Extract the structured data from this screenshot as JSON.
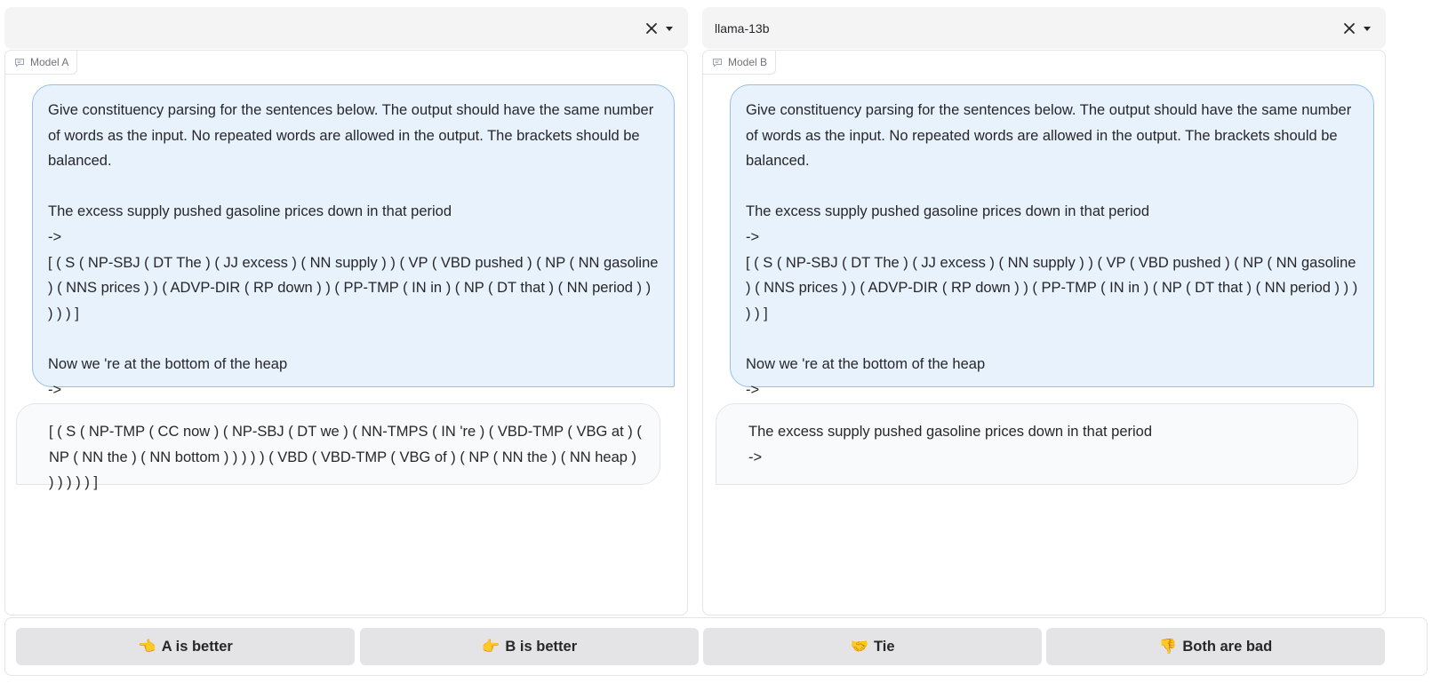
{
  "model_a": {
    "selector_value": "",
    "label": "Model A",
    "prompt": "Give constituency parsing for the sentences below. The output should have the same number of words as the input. No repeated words are allowed in the output. The brackets should be balanced.\n\nThe excess supply pushed gasoline prices down in that period\n->\n[ ( S ( NP-SBJ ( DT The ) ( JJ excess ) ( NN supply ) ) ( VP ( VBD pushed ) ( NP ( NN gasoline ) ( NNS prices ) ) ( ADVP-DIR ( RP down ) ) ( PP-TMP ( IN in ) ( NP ( DT that ) ( NN period ) ) ) ) ) ]\n\nNow we 're at the bottom of the heap\n->",
    "response": "[ ( S ( NP-TMP ( CC now ) ( NP-SBJ ( DT we ) ( NN-TMPS ( IN 're ) ( VBD-TMP ( VBG at ) ( NP ( NN the ) ( NN bottom ) ) ) ) ) ( VBD ( VBD-TMP ( VBG of ) ( NP ( NN the ) ( NN heap ) ) ) ) ) ) ]"
  },
  "model_b": {
    "selector_value": "llama-13b",
    "label": "Model B",
    "prompt": "Give constituency parsing for the sentences below. The output should have the same number of words as the input. No repeated words are allowed in the output. The brackets should be balanced.\n\nThe excess supply pushed gasoline prices down in that period\n->\n[ ( S ( NP-SBJ ( DT The ) ( JJ excess ) ( NN supply ) ) ( VP ( VBD pushed ) ( NP ( NN gasoline ) ( NNS prices ) ) ( ADVP-DIR ( RP down ) ) ( PP-TMP ( IN in ) ( NP ( DT that ) ( NN period ) ) ) ) ) ]\n\nNow we 're at the bottom of the heap\n->",
    "response": "The excess supply pushed gasoline prices down in that period\n->"
  },
  "votes": [
    {
      "emoji": "👈",
      "label": "A is better"
    },
    {
      "emoji": "👉",
      "label": "B is better"
    },
    {
      "emoji": "🤝",
      "label": "Tie"
    },
    {
      "emoji": "👎",
      "label": "Both are bad"
    }
  ],
  "icons": {
    "clear": "close-icon",
    "dropdown": "chevron-down-icon",
    "chat": "chat-icon"
  }
}
